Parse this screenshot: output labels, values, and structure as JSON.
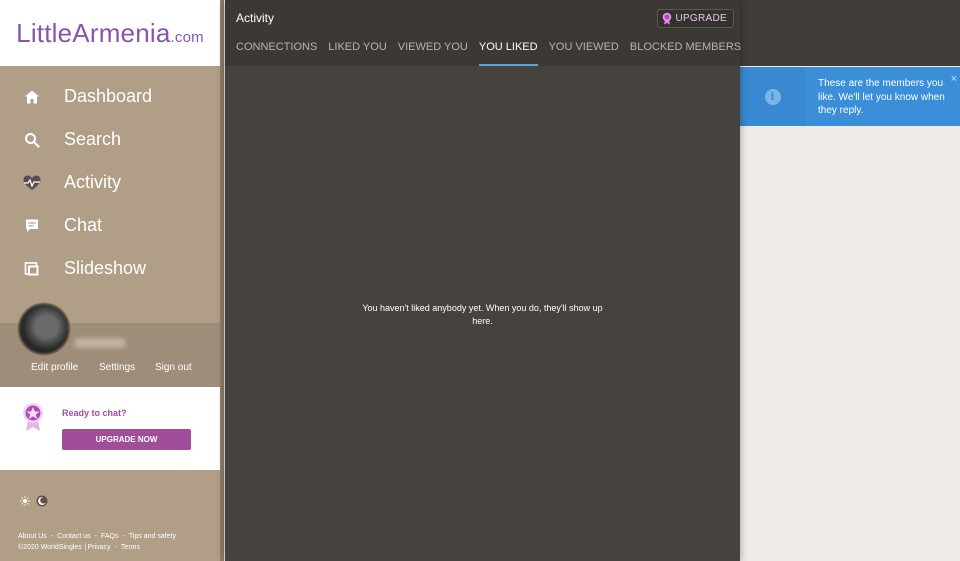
{
  "sidebar": {
    "logo": {
      "main": "LittleArmenia",
      "suffix": ".com"
    },
    "nav": [
      {
        "label": "Dashboard",
        "icon": "home-icon"
      },
      {
        "label": "Search",
        "icon": "search-icon"
      },
      {
        "label": "Activity",
        "icon": "heartbeat-icon"
      },
      {
        "label": "Chat",
        "icon": "chat-icon"
      },
      {
        "label": "Slideshow",
        "icon": "slideshow-icon"
      }
    ],
    "profile_links": {
      "edit": "Edit profile",
      "settings": "Settings",
      "signout": "Sign out"
    },
    "promo": {
      "title": "Ready to chat?",
      "button": "UPGRADE NOW"
    },
    "footer": {
      "about": "About Us",
      "contact": "Contact us",
      "faqs": "FAQs",
      "tips": "Tips and safety",
      "copyright": "©2020 WorldSingles",
      "privacy": "Privacy",
      "terms": "Terms"
    }
  },
  "modal": {
    "title": "Activity",
    "upgrade_label": "UPGRADE",
    "tabs": [
      "CONNECTIONS",
      "LIKED YOU",
      "VIEWED YOU",
      "YOU LIKED",
      "YOU VIEWED",
      "BLOCKED MEMBERS"
    ],
    "active_tab": "YOU LIKED",
    "empty_message": "You haven't liked anybody yet. When you do, they'll show up here."
  },
  "toast": {
    "message": "These are the members you like. We'll let you know when they reply.",
    "close": "×",
    "icon": "i"
  },
  "colors": {
    "sidebar": "#b09e87",
    "brand_purple": "#8a55a8",
    "modal_bg": "#46433e",
    "active_tab_underline": "#5aa0e0",
    "toast_bg": "#3a8fd8"
  }
}
